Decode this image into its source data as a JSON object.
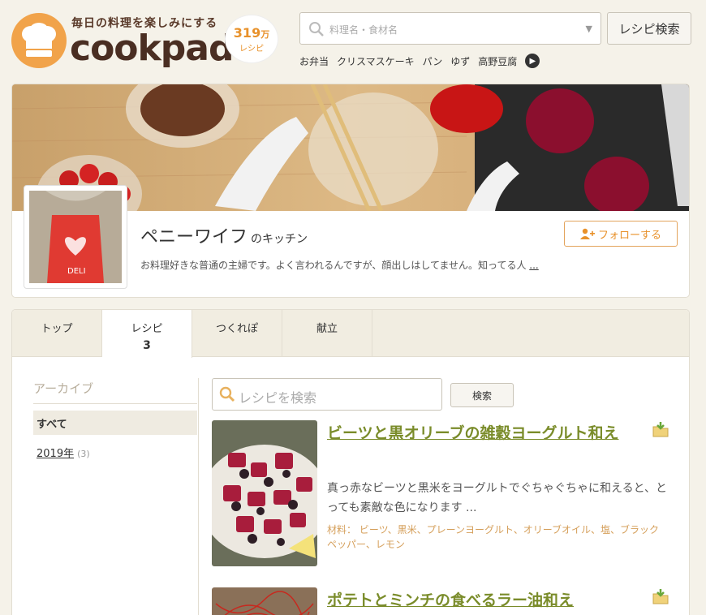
{
  "header": {
    "tagline": "毎日の料理を楽しみにする",
    "brand": "cookpad",
    "recipe_count": "319",
    "recipe_count_unit": "万",
    "recipe_count_label": "レシピ",
    "search_placeholder": "料理名・食材名",
    "search_button": "レシピ検索",
    "keywords": [
      "お弁当",
      "クリスマスケーキ",
      "パン",
      "ゆず",
      "高野豆腐"
    ]
  },
  "profile": {
    "name": "ペニーワイフ",
    "name_suffix": "のキッチン",
    "follow_label": "フォローする",
    "bio": "お料理好きな普通の主婦です。よく言われるんですが、顔出しはしてません。知ってる人",
    "bio_more": "..."
  },
  "tabs": [
    {
      "label": "トップ",
      "count": ""
    },
    {
      "label": "レシピ",
      "count": "3"
    },
    {
      "label": "つくれぽ",
      "count": ""
    },
    {
      "label": "献立",
      "count": ""
    }
  ],
  "sidebar": {
    "title": "アーカイブ",
    "all_label": "すべて",
    "year_label": "2019年",
    "year_count": "(3)"
  },
  "recipe_search": {
    "placeholder": "レシピを検索",
    "button": "検索"
  },
  "recipes": [
    {
      "title": "ビーツと黒オリーブの雑穀ヨーグルト和え",
      "description": "真っ赤なビーツと黒米をヨーグルトでぐちゃぐちゃに和えると、とっても素敵な色になります ...",
      "ingredients": "材料： ビーツ、黒米、プレーンヨーグルト、オリーブオイル、塩、ブラックペッパー、レモン"
    },
    {
      "title": "ポテトとミンチの食べるラー油和え",
      "description": "",
      "ingredients": ""
    }
  ],
  "colors": {
    "brand_orange": "#f1a34a",
    "title_green": "#7a8c2a",
    "ingredient_tan": "#d59f5a"
  }
}
